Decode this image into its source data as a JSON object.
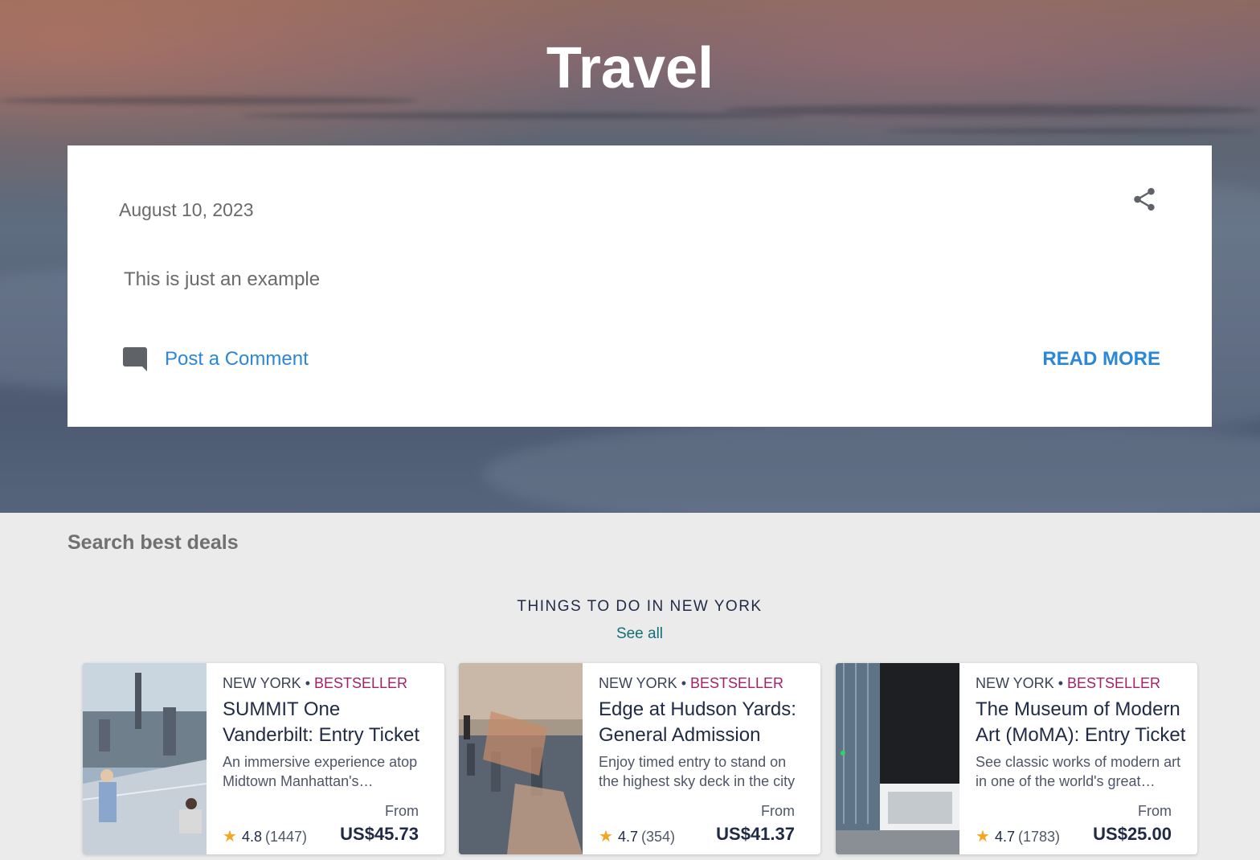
{
  "site": {
    "title": "Travel"
  },
  "post": {
    "date": "August 10, 2023",
    "body": "This is just an example",
    "comment_label": "Post a Comment",
    "read_more_label": "READ MORE"
  },
  "deals": {
    "section_title": "Search best deals",
    "widget_title": "THINGS TO DO IN NEW YORK",
    "see_all_label": "See all",
    "cards": [
      {
        "location": "NEW YORK",
        "badge": "BESTSELLER",
        "title": "SUMMIT One Vanderbilt: Entry Ticket",
        "description": "An immersive experience atop Midtown Manhattan's skyscrapers",
        "from_label": "From",
        "price": "US$45.73",
        "rating": "4.8",
        "reviews": "(1447)"
      },
      {
        "location": "NEW YORK",
        "badge": "BESTSELLER",
        "title": "Edge at Hudson Yards: General Admission",
        "description": "Enjoy timed entry to stand on the highest sky deck in the city",
        "from_label": "From",
        "price": "US$41.37",
        "rating": "4.7",
        "reviews": "(354)"
      },
      {
        "location": "NEW YORK",
        "badge": "BESTSELLER",
        "title": "The Museum of Modern Art (MoMA): Entry Ticket",
        "description": "See classic works of modern art in one of the world's great museums",
        "from_label": "From",
        "price": "US$25.00",
        "rating": "4.7",
        "reviews": "(1783)"
      }
    ]
  },
  "icons": {
    "share": "share-icon",
    "comment": "comment-icon",
    "star": "star-icon"
  },
  "colors": {
    "link": "#2b87d8",
    "badge": "#a1226b",
    "see_all": "#127176",
    "star": "#f4a522"
  }
}
